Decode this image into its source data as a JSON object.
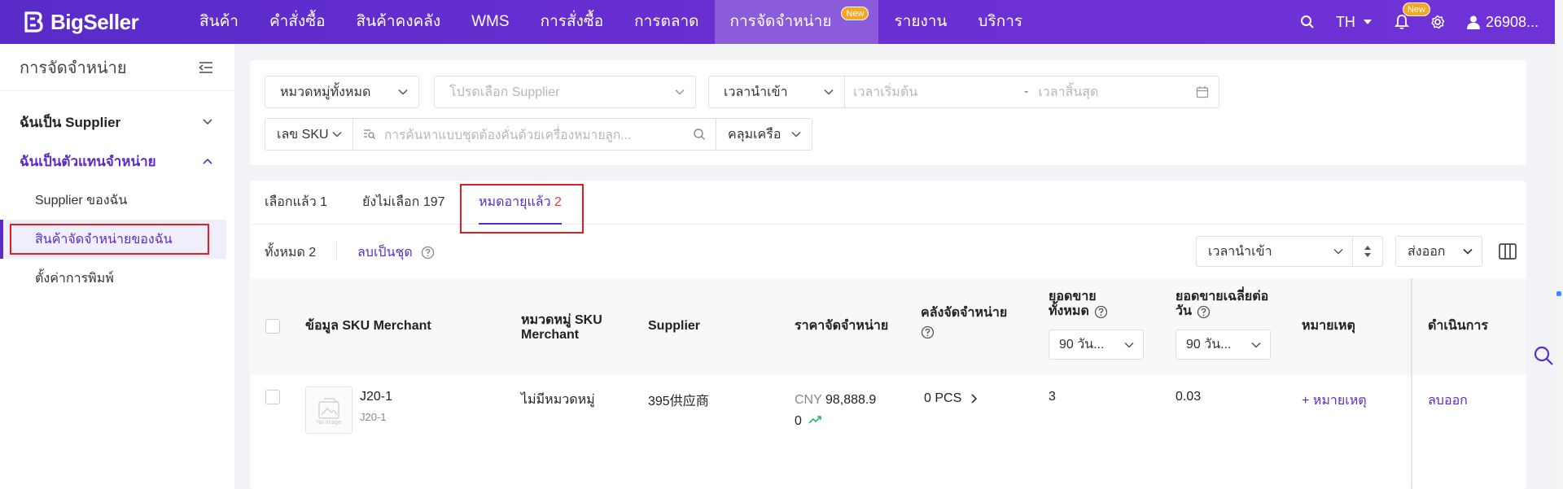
{
  "brand": {
    "name": "BigSeller"
  },
  "nav": {
    "items": [
      {
        "label": "สินค้า"
      },
      {
        "label": "คำสั่งซื้อ"
      },
      {
        "label": "สินค้าคงคลัง"
      },
      {
        "label": "WMS"
      },
      {
        "label": "การสั่งซื้อ"
      },
      {
        "label": "การตลาด"
      },
      {
        "label": "การจัดจำหน่าย",
        "badge": "New"
      },
      {
        "label": "รายงาน"
      },
      {
        "label": "บริการ"
      }
    ],
    "language": "TH",
    "notification_badge": "New",
    "user_id": "26908..."
  },
  "sidebar": {
    "title": "การจัดจำหน่าย",
    "groups": [
      {
        "label": "ฉันเป็น Supplier"
      },
      {
        "label": "ฉันเป็นตัวแทนจำหน่าย"
      }
    ],
    "sub_items": [
      {
        "label": "Supplier ของฉัน"
      },
      {
        "label": "สินค้าจัดจำหน่ายของฉัน"
      },
      {
        "label": "ตั้งค่าการพิมพ์"
      }
    ]
  },
  "filters": {
    "category": "หมวดหมู่ทั้งหมด",
    "supplier_placeholder": "โปรดเลือก Supplier",
    "time_type": "เวลานำเข้า",
    "start_placeholder": "เวลาเริ่มต้น",
    "range_sep": "-",
    "end_placeholder": "เวลาสิ้นสุด",
    "search_field": "เลข SKU",
    "search_placeholder": "การค้นหาแบบชุดต้องคั่นด้วยเครื่องหมายลูก...",
    "match_mode": "คลุมเครือ"
  },
  "tabs": [
    {
      "label": "เลือกแล้ว",
      "count": "1"
    },
    {
      "label": "ยังไม่เลือก",
      "count": "197"
    },
    {
      "label": "หมดอายุแล้ว",
      "count": "2"
    }
  ],
  "toolbar": {
    "total_label": "ทั้งหมด 2",
    "batch_delete": "ลบเป็นชุด",
    "sort_field": "เวลานำเข้า",
    "export": "ส่งออก"
  },
  "table": {
    "headers": {
      "sku_info": "ข้อมูล SKU Merchant",
      "category_l1": "หมวดหมู่ SKU",
      "category_l2": "Merchant",
      "supplier": "Supplier",
      "price": "ราคาจัดจำหน่าย",
      "warehouse": "คลังจัดจำหน่าย",
      "total_sales_l1": "ยอดขาย",
      "total_sales_l2": "ทั้งหมด",
      "total_sales_period": "90 วัน...",
      "avg_sales_l1": "ยอดขายเฉลี่ยต่อ",
      "avg_sales_l2": "วัน",
      "avg_sales_period": "90 วัน...",
      "note": "หมายเหตุ",
      "action": "ดำเนินการ"
    },
    "rows": [
      {
        "image_text": "No Image",
        "sku": "J20-1",
        "sku_sub": "J20-1",
        "category": "ไม่มีหมวดหมู่",
        "supplier": "395供应商",
        "currency": "CNY",
        "price_l1": "98,888.9",
        "price_l2": "0",
        "warehouse": "0 PCS",
        "total_sales": "3",
        "avg_sales": "0.03",
        "note_action": "+ หมายเหตุ",
        "action": "ลบออก"
      }
    ]
  },
  "colors": {
    "primary": "#5b2bc6",
    "nav_bg": "#6a2fd3",
    "highlight": "#e02020",
    "danger_count": "#e63a3a"
  }
}
